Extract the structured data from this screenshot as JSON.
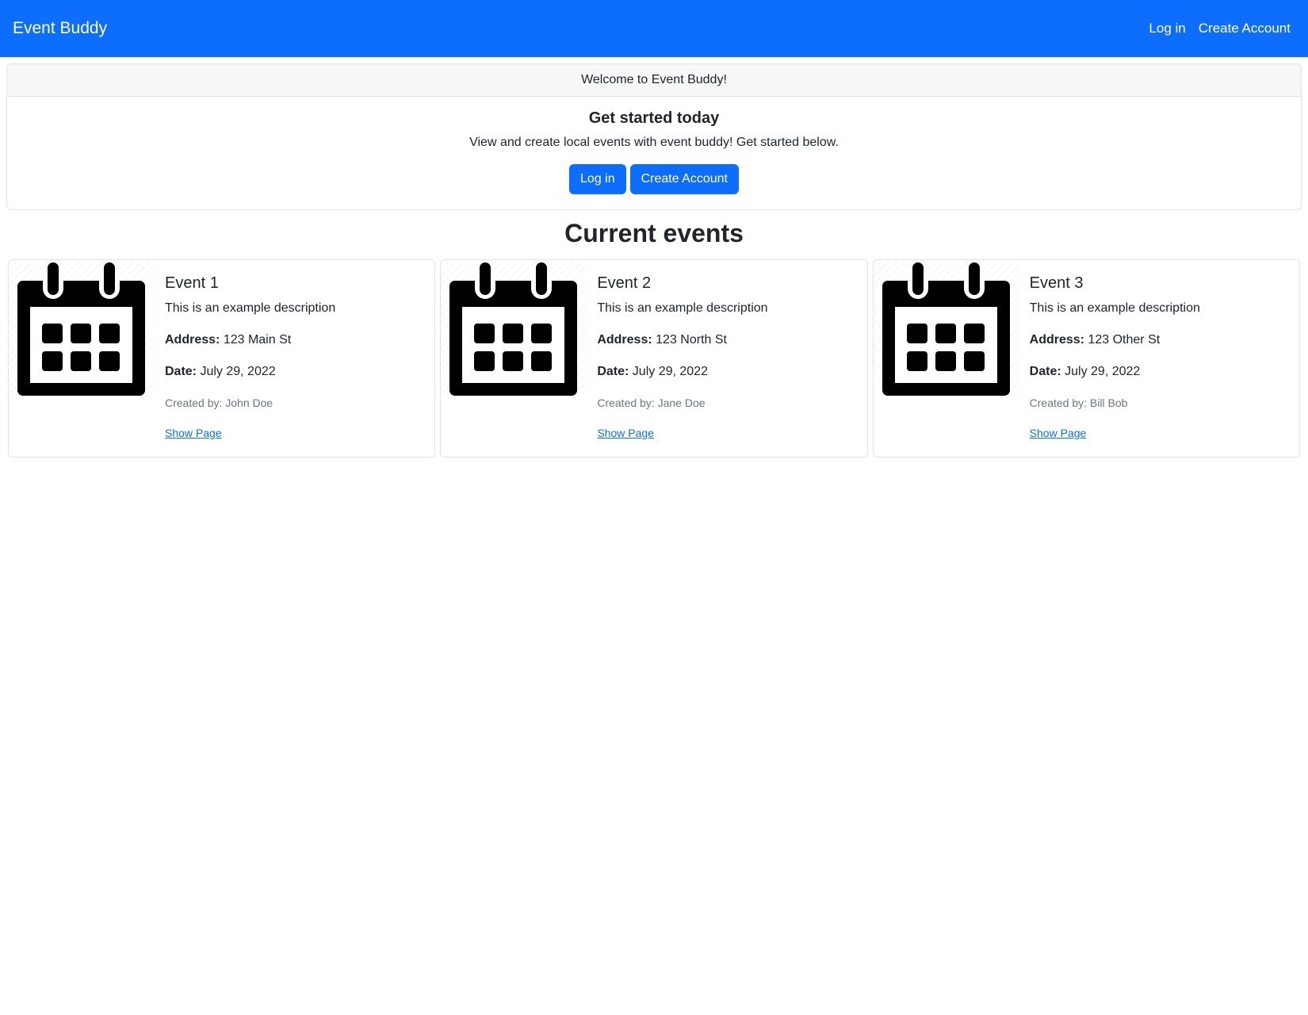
{
  "navbar": {
    "brand": "Event Buddy",
    "links": [
      "Log in",
      "Create Account"
    ]
  },
  "welcome": {
    "header": "Welcome to Event Buddy!",
    "title": "Get started today",
    "text": "View and create local events with event buddy! Get started below.",
    "login_label": "Log in",
    "create_label": "Create Account"
  },
  "events_heading": "Current events",
  "events": [
    {
      "title": "Event 1",
      "description": "This is an example description",
      "address_label": "Address:",
      "address": "123 Main St",
      "date_label": "Date:",
      "date": "July 29, 2022",
      "created_by": "Created by: John Doe",
      "link": "Show Page",
      "icon": "calendar-icon"
    },
    {
      "title": "Event 2",
      "description": "This is an example description",
      "address_label": "Address:",
      "address": "123 North St",
      "date_label": "Date:",
      "date": "July 29, 2022",
      "created_by": "Created by: Jane Doe",
      "link": "Show Page",
      "icon": "calendar-icon"
    },
    {
      "title": "Event 3",
      "description": "This is an example description",
      "address_label": "Address:",
      "address": "123 Other St",
      "date_label": "Date:",
      "date": "July 29, 2022",
      "created_by": "Created by: Bill Bob",
      "link": "Show Page",
      "icon": "calendar-icon"
    }
  ],
  "colors": {
    "primary": "#0d6efd",
    "text": "#212529",
    "muted": "#6c757d",
    "border": "#dee2e6"
  }
}
